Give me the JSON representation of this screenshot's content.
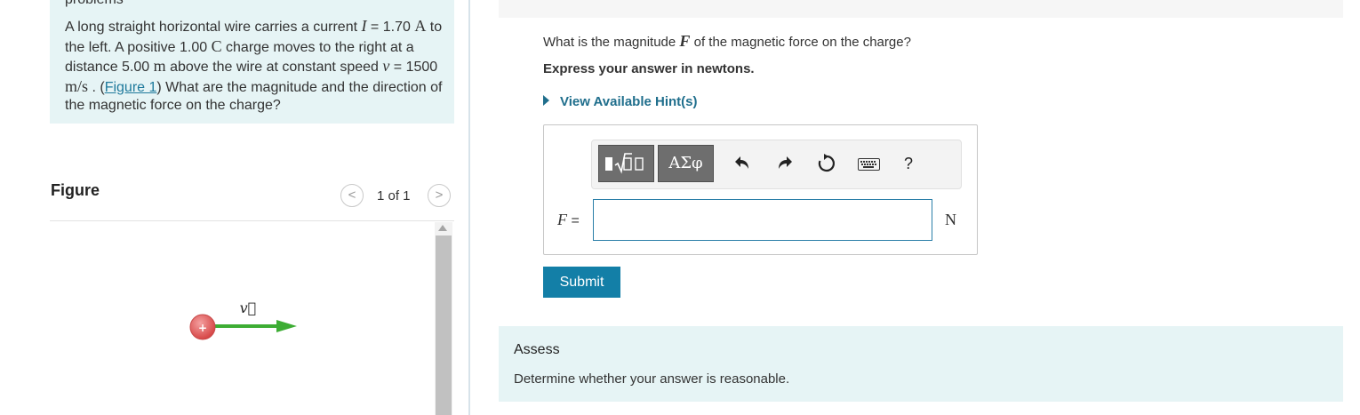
{
  "problem": {
    "cutoff_text": "problems",
    "text_1": "A long straight horizontal wire carries a current ",
    "current_symbol": "I",
    "text_2": " = 1.70 ",
    "current_unit": "A",
    "text_3": " to the left. A positive 1.00 ",
    "charge_unit": "C",
    "text_4": " charge moves to the right at a distance 5.00 ",
    "distance_unit": "m",
    "text_5": " above the wire at constant speed ",
    "speed_symbol": "v",
    "text_6": " = 1500 ",
    "speed_unit": "m/s",
    "text_7": " . (",
    "figure_link": "Figure 1",
    "text_8": ") What are the magnitude and the direction of the magnetic force on the charge?"
  },
  "figure": {
    "title": "Figure",
    "pager_prev": "<",
    "pager_text": "1 of 1",
    "pager_next": ">",
    "charge_sign": "+",
    "velocity_label": "v⃗",
    "colors": {
      "charge": "#e35b5b",
      "arrow": "#3dad34"
    }
  },
  "question": {
    "text_1": "What is the magnitude ",
    "force_symbol": "F",
    "text_2": " of the magnetic force on the charge?",
    "express": "Express your answer in newtons.",
    "hint_link": "View Available Hint(s)"
  },
  "toolbar": {
    "greek_label": "ΑΣφ",
    "undo_icon": "undo-icon",
    "redo_icon": "redo-icon",
    "reset_icon": "reset-icon",
    "keyboard_icon": "keyboard-icon",
    "help_label": "?"
  },
  "answer": {
    "label_symbol": "F",
    "label_eq": " =",
    "value": "",
    "unit": "N",
    "submit_label": "Submit"
  },
  "assess": {
    "title": "Assess",
    "text": "Determine whether your answer is reasonable."
  },
  "colors": {
    "panel_bg": "#e6f4f5",
    "accent": "#137fa7",
    "link": "#1f6e8c"
  }
}
